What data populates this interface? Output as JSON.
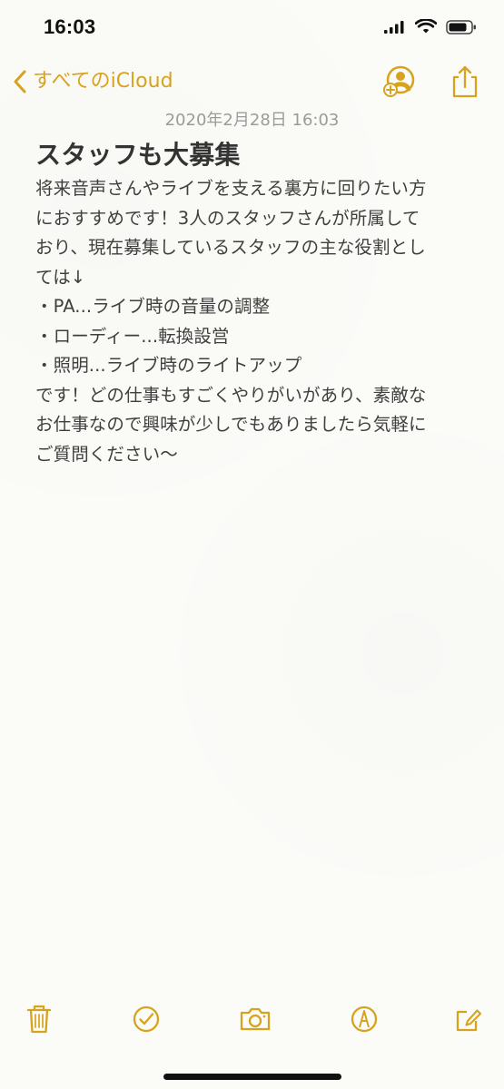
{
  "status_bar": {
    "time": "16:03",
    "icons": [
      "signal-icon",
      "wifi-icon",
      "battery-icon"
    ]
  },
  "nav": {
    "back_label": "すべてのiCloud",
    "actions": [
      "add-person-icon",
      "share-icon"
    ]
  },
  "note": {
    "timestamp": "2020年2月28日 16:03",
    "title": "スタッフも大募集",
    "body_lines": [
      "将来音声さんやライブを支える裏方に回りたい方",
      "におすすめです！3人のスタッフさんが所属して",
      "おり、現在募集しているスタッフの主な役割とし",
      "ては↓",
      "・PA...ライブ時の音量の調整",
      "・ローディー...転換設営",
      "・照明...ライブ時のライトアップ",
      "です！どの仕事もすごくやりがいがあり、素敵な",
      "お仕事なので興味が少しでもありましたら気軽に",
      "ご質問ください〜"
    ]
  },
  "toolbar": {
    "items": [
      "trash-icon",
      "checklist-icon",
      "camera-icon",
      "markup-icon",
      "compose-icon"
    ]
  },
  "colors": {
    "accent": "#d7a31f",
    "background": "#fbfbf8",
    "text": "#3f3f3f",
    "timestamp": "#9b9b9b"
  }
}
